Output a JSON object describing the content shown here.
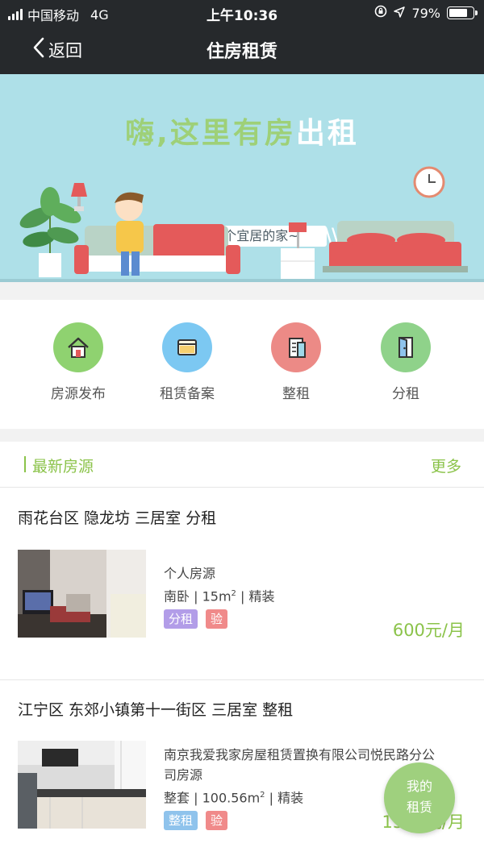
{
  "status_bar": {
    "carrier": "中国移动",
    "network": "4G",
    "time": "上午10:36",
    "battery": "79%",
    "battery_level": 0.79
  },
  "nav": {
    "back_label": "返回",
    "title": "住房租赁"
  },
  "banner": {
    "headline_main": "嗨,这里有房",
    "headline_accent": "出租",
    "subline": "给您一个宜居的家~"
  },
  "menu": [
    {
      "label": "房源发布",
      "icon": "house-icon",
      "color": "#8fd270"
    },
    {
      "label": "租赁备案",
      "icon": "folder-icon",
      "color": "#7cc8f2"
    },
    {
      "label": "整租",
      "icon": "building-icon",
      "color": "#ec8a86"
    },
    {
      "label": "分租",
      "icon": "door-icon",
      "color": "#8fd28a"
    }
  ],
  "listings_section": {
    "title": "最新房源",
    "more": "更多",
    "accent": "#8bc34a"
  },
  "listings": [
    {
      "title": "雨花台区 隐龙坊 三居室 分租",
      "source": "个人房源",
      "room": "南卧",
      "area": "15m",
      "area_sup": "2",
      "decor": "精装",
      "tags": [
        {
          "label": "分租",
          "color": "#b29de8"
        },
        {
          "label": "验",
          "color": "#f08a8a"
        }
      ],
      "price": "600元/月"
    },
    {
      "title": "江宁区 东郊小镇第十一街区 三居室 整租",
      "source_line1": "南京我爱我家房屋租赁置换有限公司悦民路分公",
      "source_line2": "司房源",
      "room": "整套",
      "area": "100.56m",
      "area_sup": "2",
      "decor": "精装",
      "tags": [
        {
          "label": "整租",
          "color": "#8fc3ec"
        },
        {
          "label": "验",
          "color": "#f08a8a"
        }
      ],
      "price": "1500元/月"
    }
  ],
  "fab": {
    "line1": "我的",
    "line2": "租赁"
  }
}
